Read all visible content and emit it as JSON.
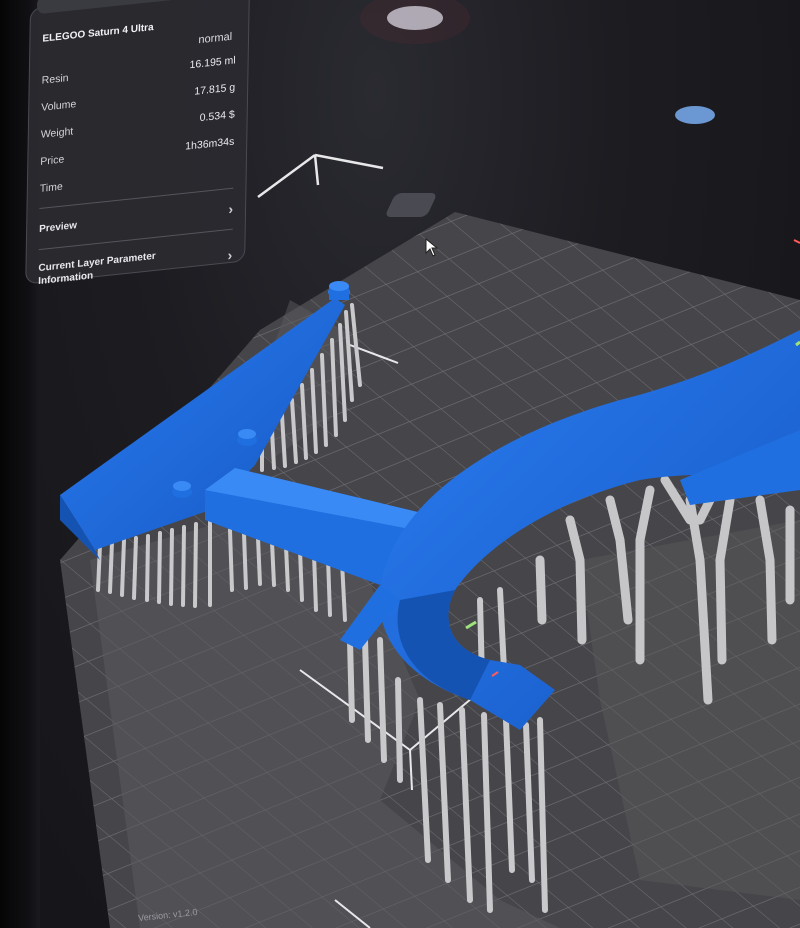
{
  "app": {
    "printer_name": "ELEGOO Saturn 4 Ultra",
    "mode": "normal",
    "version": "Version: v1.2.0"
  },
  "stats": [
    {
      "label": "Resin",
      "value": "16.195 ml"
    },
    {
      "label": "Volume",
      "value": "17.815 g"
    },
    {
      "label": "Weight",
      "value": "0.534 $"
    },
    {
      "label": "Price",
      "value": "1h36m34s"
    },
    {
      "label": "Time",
      "value": ""
    }
  ],
  "menu": {
    "preview_label": "Preview",
    "layer_info_line1": "Current Layer Parameter",
    "layer_info_line2": "Information"
  },
  "colors": {
    "model": "#1f6fe0",
    "model_shadow": "#1553b3",
    "supports": "#c4c4c6",
    "plate": "#4a4a4d",
    "grid": "#7a7a7e",
    "panel": "#2a2a30"
  },
  "icons": {
    "chevron": "chevron-right-icon",
    "cursor": "mouse-pointer-icon",
    "gizmo": "axis-gizmo-icon"
  }
}
